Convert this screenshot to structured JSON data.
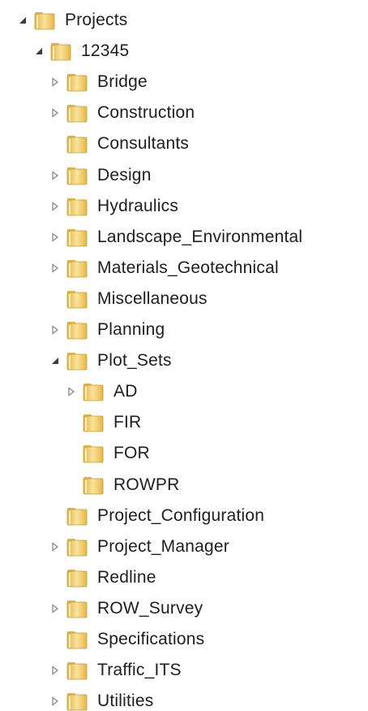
{
  "tree": {
    "items": [
      {
        "label": "Projects",
        "toggle": "expanded",
        "level": 0
      },
      {
        "label": "12345",
        "toggle": "expanded",
        "level": 1
      },
      {
        "label": "Bridge",
        "toggle": "collapsed",
        "level": 2
      },
      {
        "label": "Construction",
        "toggle": "collapsed",
        "level": 2
      },
      {
        "label": "Consultants",
        "toggle": "none",
        "level": 2
      },
      {
        "label": "Design",
        "toggle": "collapsed",
        "level": 2
      },
      {
        "label": "Hydraulics",
        "toggle": "collapsed",
        "level": 2
      },
      {
        "label": "Landscape_Environmental",
        "toggle": "collapsed",
        "level": 2
      },
      {
        "label": "Materials_Geotechnical",
        "toggle": "collapsed",
        "level": 2
      },
      {
        "label": "Miscellaneous",
        "toggle": "none",
        "level": 2
      },
      {
        "label": "Planning",
        "toggle": "collapsed",
        "level": 2
      },
      {
        "label": "Plot_Sets",
        "toggle": "expanded",
        "level": 2
      },
      {
        "label": "AD",
        "toggle": "collapsed",
        "level": 3
      },
      {
        "label": "FIR",
        "toggle": "none",
        "level": 3
      },
      {
        "label": "FOR",
        "toggle": "none",
        "level": 3
      },
      {
        "label": "ROWPR",
        "toggle": "none",
        "level": 3
      },
      {
        "label": "Project_Configuration",
        "toggle": "none",
        "level": 2
      },
      {
        "label": "Project_Manager",
        "toggle": "collapsed",
        "level": 2
      },
      {
        "label": "Redline",
        "toggle": "none",
        "level": 2
      },
      {
        "label": "ROW_Survey",
        "toggle": "collapsed",
        "level": 2
      },
      {
        "label": "Specifications",
        "toggle": "none",
        "level": 2
      },
      {
        "label": "Traffic_ITS",
        "toggle": "collapsed",
        "level": 2
      },
      {
        "label": "Utilities",
        "toggle": "collapsed",
        "level": 2
      }
    ]
  },
  "colors": {
    "text": "#1e1e1e",
    "folder_light": "#fbe39a",
    "folder_dark": "#e3b64a",
    "toggle_collapsed": "#8a8a8a",
    "toggle_expanded": "#3c3c3c"
  }
}
